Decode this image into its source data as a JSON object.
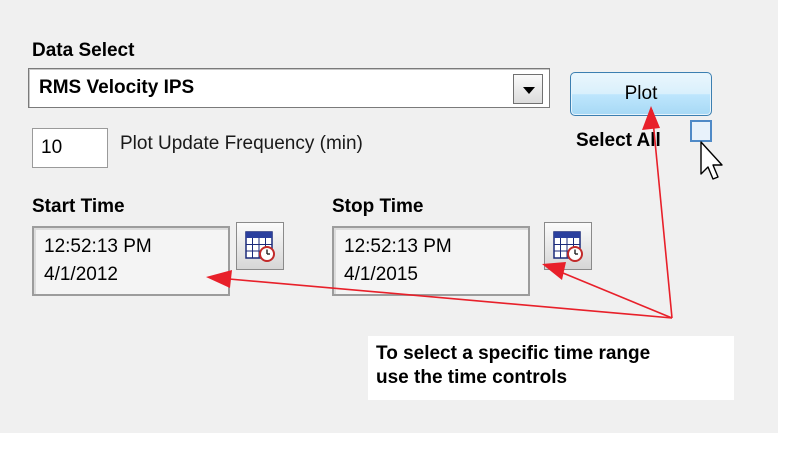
{
  "data_select": {
    "label": "Data Select",
    "selected": "RMS Velocity IPS"
  },
  "plot_button": {
    "label": "Plot"
  },
  "update_frequency": {
    "value": "10",
    "label": "Plot Update Frequency (min)"
  },
  "select_all": {
    "label": "Select All",
    "checked": false
  },
  "start_time": {
    "label": "Start Time",
    "time": "12:52:13 PM",
    "date": "4/1/2012"
  },
  "stop_time": {
    "label": "Stop Time",
    "time": "12:52:13 PM",
    "date": "4/1/2015"
  },
  "annotation": {
    "line1": "To select a specific time range",
    "line2": "use the time controls"
  },
  "icons": {
    "dropdown": "chevron-down-icon",
    "calendar": "calendar-clock-icon",
    "cursor": "mouse-pointer-icon"
  },
  "colors": {
    "annotation_arrow": "#e8202a",
    "button_border": "#3c7fb1",
    "panel_background": "#f0f0f0"
  }
}
